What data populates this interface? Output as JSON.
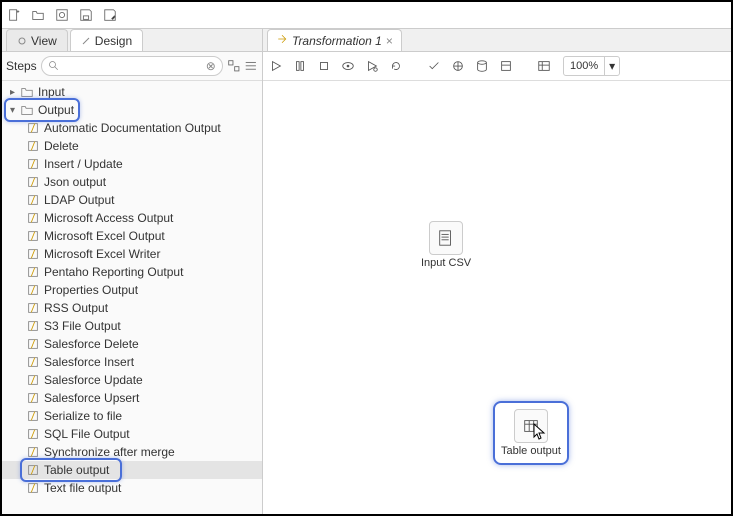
{
  "tabs": {
    "view": "View",
    "design": "Design"
  },
  "steps_label": "Steps",
  "search_placeholder": "",
  "tree": {
    "input": "Input",
    "output": "Output",
    "items": [
      "Automatic Documentation Output",
      "Delete",
      "Insert / Update",
      "Json output",
      "LDAP Output",
      "Microsoft Access Output",
      "Microsoft Excel Output",
      "Microsoft Excel Writer",
      "Pentaho Reporting Output",
      "Properties Output",
      "RSS Output",
      "S3 File Output",
      "Salesforce Delete",
      "Salesforce Insert",
      "Salesforce Update",
      "Salesforce Upsert",
      "Serialize to file",
      "SQL File Output",
      "Synchronize after merge",
      "Table output",
      "Text file output"
    ]
  },
  "editor": {
    "tab": "Transformation 1",
    "zoom": "100%"
  },
  "nodes": {
    "input_csv": "Input CSV",
    "table_output": "Table output"
  }
}
